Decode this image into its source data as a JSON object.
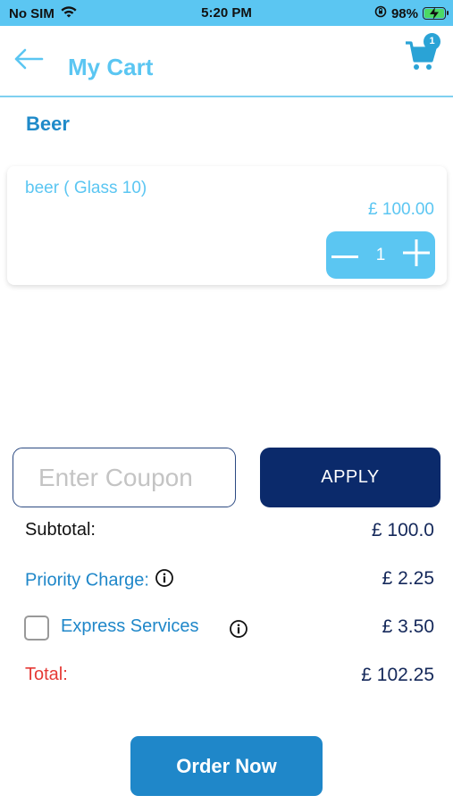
{
  "status_bar": {
    "carrier": "No SIM",
    "time": "5:20 PM",
    "battery_percent": "98%",
    "battery_level": 0.98,
    "icons": [
      "wifi-icon",
      "orientation-lock-icon",
      "battery-charging-icon"
    ]
  },
  "header": {
    "title": "My Cart",
    "cart_count": "1",
    "icons": [
      "back-arrow-icon",
      "cart-icon"
    ]
  },
  "category": {
    "name": "Beer"
  },
  "item": {
    "name": "beer ( Glass 10)",
    "price": "£ 100.00",
    "quantity": "1",
    "icons": [
      "minus-icon",
      "plus-icon"
    ]
  },
  "coupon": {
    "value": "",
    "placeholder": "Enter Coupon",
    "apply_label": "APPLY"
  },
  "summary": {
    "subtotal_label": "Subtotal:",
    "subtotal_value": "£ 100.0",
    "priority_label": "Priority Charge:",
    "priority_value": "£ 2.25",
    "express_label": "Express Services",
    "express_value": "£ 3.50",
    "express_checked": false,
    "total_label": "Total:",
    "total_value": "£ 102.25"
  },
  "order_button": {
    "label": "Order Now"
  },
  "colors": {
    "status_bar_bg": "#5bc6f2",
    "accent_light": "#5bc6f2",
    "accent": "#1f87c9",
    "navy": "#0b2a6b",
    "value_text": "#14285a",
    "total_label": "#e53935"
  }
}
